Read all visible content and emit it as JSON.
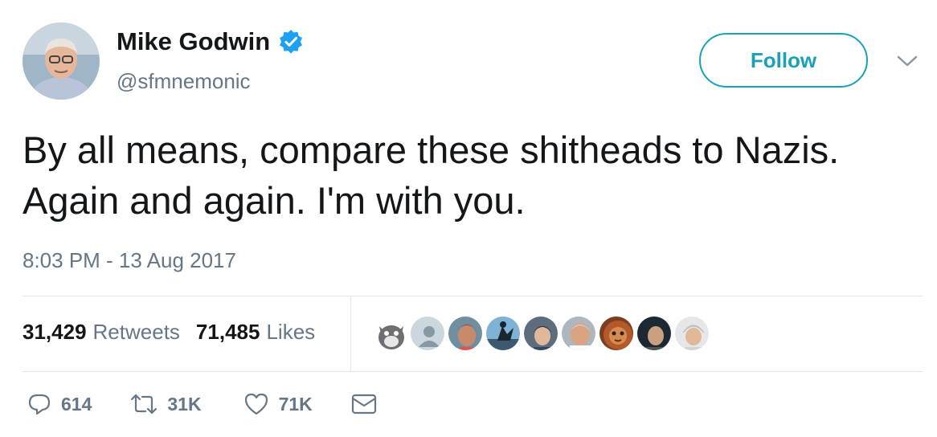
{
  "author": {
    "name": "Mike Godwin",
    "handle": "@sfmnemonic",
    "verified": true
  },
  "follow_button": {
    "label": "Follow"
  },
  "tweet": {
    "text": "By all means, compare these shitheads to Nazis. Again and again. I'm with you.",
    "timestamp": "8:03 PM - 13 Aug 2017"
  },
  "stats": {
    "retweets_count": "31,429",
    "retweets_label": "Retweets",
    "likes_count": "71,485",
    "likes_label": "Likes"
  },
  "likers": [
    {
      "name": "liker-avatar-1"
    },
    {
      "name": "liker-avatar-2"
    },
    {
      "name": "liker-avatar-3"
    },
    {
      "name": "liker-avatar-4"
    },
    {
      "name": "liker-avatar-5"
    },
    {
      "name": "liker-avatar-6"
    },
    {
      "name": "liker-avatar-7"
    },
    {
      "name": "liker-avatar-8"
    },
    {
      "name": "liker-avatar-9"
    }
  ],
  "actions": {
    "reply_count": "614",
    "retweet_count": "31K",
    "like_count": "71K"
  },
  "colors": {
    "accent": "#1aa1b7",
    "verified": "#1da1f2",
    "text": "#14171a",
    "muted": "#657786"
  },
  "icons": [
    "verified-badge-icon",
    "chevron-down-icon",
    "reply-icon",
    "retweet-icon",
    "heart-icon",
    "envelope-icon"
  ]
}
